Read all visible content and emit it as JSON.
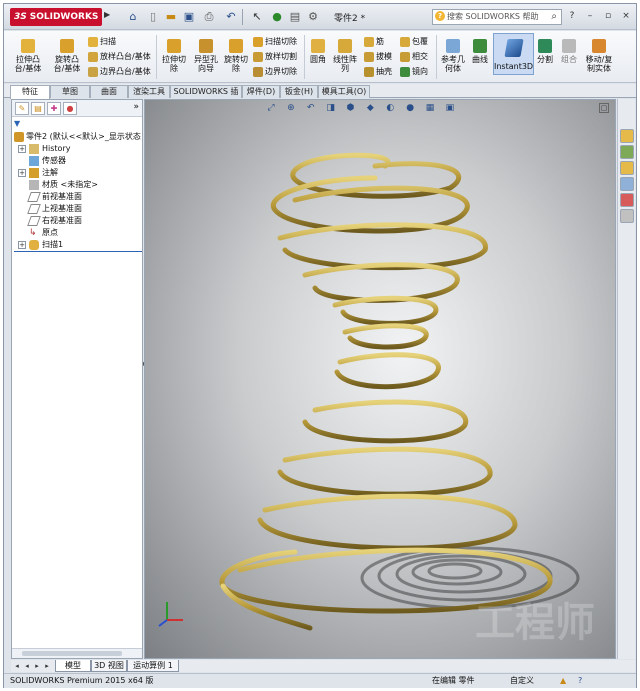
{
  "app": {
    "logo_prefix": "3S",
    "logo_text": "SOLIDWORKS",
    "document_title": "零件2 *",
    "help_search_placeholder": "搜索 SOLIDWORKS 帮助"
  },
  "quick_access": {
    "icons": [
      "new-document-icon",
      "open-icon",
      "save-icon",
      "print-icon",
      "undo-icon",
      "select-icon",
      "rebuild-icon",
      "file-properties-icon",
      "options-icon"
    ]
  },
  "ribbon": {
    "large_buttons": [
      {
        "label": "拉伸凸\n台/基体",
        "icon": "extrude-boss-icon"
      },
      {
        "label": "旋转凸\n台/基体",
        "icon": "revolve-boss-icon"
      },
      {
        "label": "拉伸切\n除",
        "icon": "extrude-cut-icon"
      },
      {
        "label": "异型孔\n向导",
        "icon": "hole-wizard-icon"
      },
      {
        "label": "旋转切\n除",
        "icon": "revolve-cut-icon"
      },
      {
        "label": "圆角",
        "icon": "fillet-icon"
      },
      {
        "label": "线性阵\n列",
        "icon": "linear-pattern-icon"
      },
      {
        "label": "参考几\n何体",
        "icon": "reference-geometry-icon"
      },
      {
        "label": "曲线",
        "icon": "curves-icon"
      },
      {
        "label": "Instant3D",
        "icon": "instant3d-icon"
      },
      {
        "label": "分割",
        "icon": "split-icon"
      },
      {
        "label": "组合",
        "icon": "combine-icon"
      },
      {
        "label": "移动/复\n制实体",
        "icon": "move-copy-body-icon"
      }
    ],
    "small_buttons": [
      {
        "label": "扫描",
        "icon": "sweep-icon"
      },
      {
        "label": "放样凸台/基体",
        "icon": "loft-boss-icon"
      },
      {
        "label": "边界凸台/基体",
        "icon": "boundary-boss-icon"
      },
      {
        "label": "扫描切除",
        "icon": "swept-cut-icon"
      },
      {
        "label": "放样切割",
        "icon": "lofted-cut-icon"
      },
      {
        "label": "边界切除",
        "icon": "boundary-cut-icon"
      },
      {
        "label": "筋",
        "icon": "rib-icon"
      },
      {
        "label": "拔模",
        "icon": "draft-icon"
      },
      {
        "label": "抽壳",
        "icon": "shell-icon"
      },
      {
        "label": "包覆",
        "icon": "wrap-icon"
      },
      {
        "label": "相交",
        "icon": "intersect-icon"
      },
      {
        "label": "镜向",
        "icon": "mirror-icon"
      }
    ]
  },
  "command_tabs": [
    "特征",
    "草图",
    "曲面",
    "渲染工具",
    "SOLIDWORKS 插件",
    "焊件(D)",
    "钣金(H)",
    "模具工具(O)"
  ],
  "feature_manager": {
    "root_label": "零件2 (默认<<默认>_显示状态",
    "items": [
      {
        "label": "History",
        "expandable": true,
        "icon": "history-icon"
      },
      {
        "label": "传感器",
        "expandable": false,
        "icon": "sensor-icon"
      },
      {
        "label": "注解",
        "expandable": true,
        "icon": "annotations-icon"
      },
      {
        "label": "材质 <未指定>",
        "expandable": false,
        "icon": "material-icon"
      },
      {
        "label": "前视基准面",
        "expandable": false,
        "icon": "plane-icon"
      },
      {
        "label": "上视基准面",
        "expandable": false,
        "icon": "plane-icon"
      },
      {
        "label": "右视基准面",
        "expandable": false,
        "icon": "plane-icon"
      },
      {
        "label": "原点",
        "expandable": false,
        "icon": "origin-icon"
      },
      {
        "label": "扫描1",
        "expandable": true,
        "icon": "sweep-feature-icon"
      }
    ]
  },
  "viewport": {
    "watermark": "工程师",
    "spring_color": "#b89a3a"
  },
  "bottom_tabs": [
    "模型",
    "3D 视图",
    "运动算例 1"
  ],
  "status": {
    "product": "SOLIDWORKS Premium 2015 x64 版",
    "editing": "在编辑 零件",
    "units": "自定义"
  }
}
